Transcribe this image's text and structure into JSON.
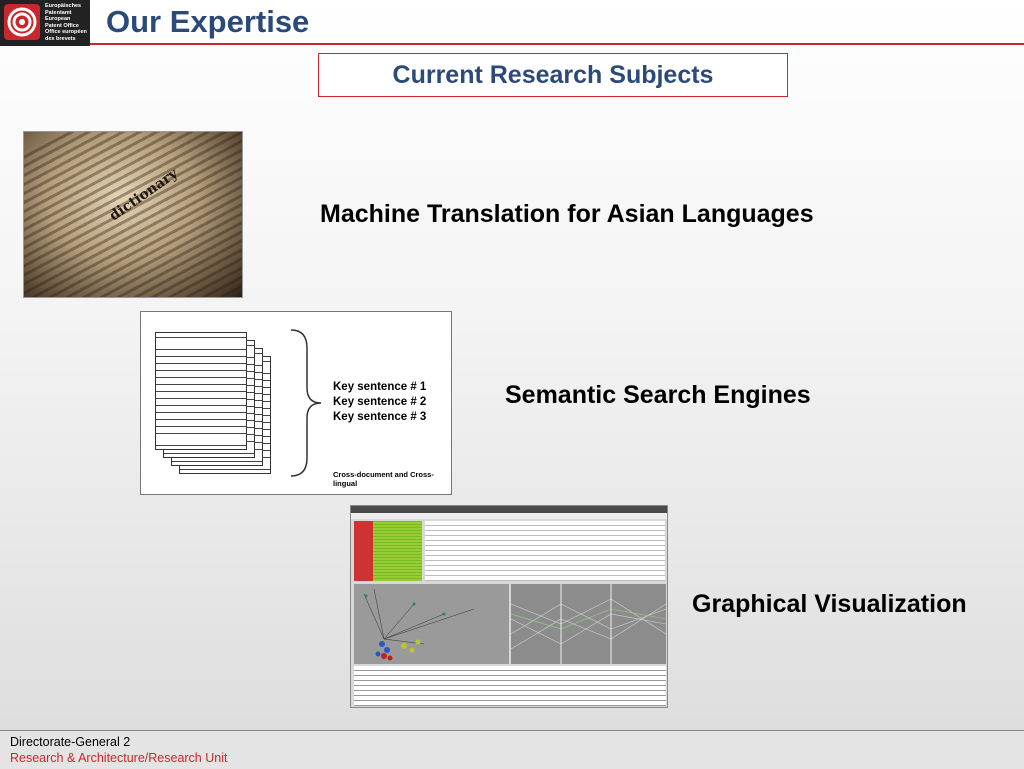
{
  "logo": {
    "lines": [
      "Europäisches",
      "Patentamt",
      "European",
      "Patent Office",
      "Office européen",
      "des brevets"
    ]
  },
  "header": {
    "title": "Our Expertise",
    "subtitle": "Current Research Subjects"
  },
  "topics": [
    {
      "label": "Machine Translation for Asian Languages"
    },
    {
      "label": "Semantic Search Engines"
    },
    {
      "label": "Graphical Visualization"
    }
  ],
  "semantic_figure": {
    "key_sentences": [
      "Key sentence # 1",
      "Key sentence # 2",
      "Key sentence # 3"
    ],
    "caption": "Cross-document and Cross-lingual"
  },
  "dictionary_image": {
    "word": "dictionary"
  },
  "footer": {
    "line1": "Directorate-General 2",
    "line2": "Research & Architecture/Research Unit"
  },
  "colors": {
    "title": "#2c4a78",
    "accent": "#c8272d"
  }
}
